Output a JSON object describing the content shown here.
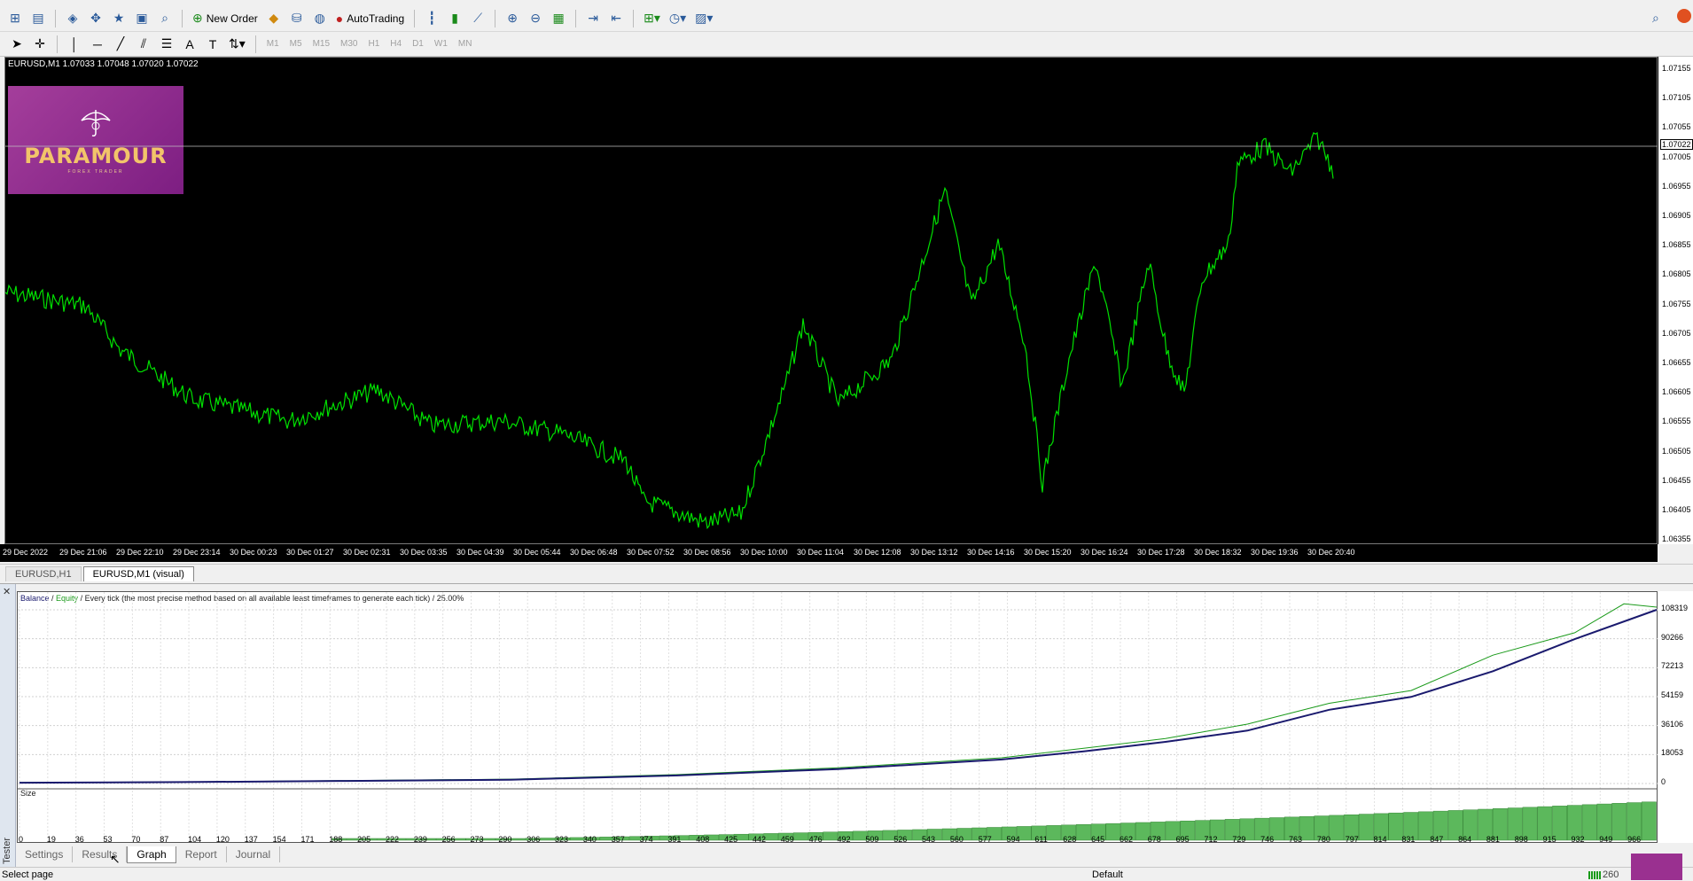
{
  "toolbar": {
    "new_order": "New Order",
    "auto_trading": "AutoTrading",
    "timeframes": [
      "M1",
      "M5",
      "M15",
      "M30",
      "H1",
      "H4",
      "D1",
      "W1",
      "MN"
    ]
  },
  "chart": {
    "info": "EURUSD,M1  1.07033 1.07048 1.07020 1.07022",
    "current_price": "1.07022",
    "logo_word": "PARAMOUR",
    "logo_sub": "FOREX TRADER",
    "line_color": "#00e000",
    "price_ticks": [
      "1.07155",
      "1.07105",
      "1.07055",
      "1.07005",
      "1.06955",
      "1.06905",
      "1.06855",
      "1.06805",
      "1.06755",
      "1.06705",
      "1.06655",
      "1.06605",
      "1.06555",
      "1.06505",
      "1.06455",
      "1.06405",
      "1.06355"
    ],
    "time_ticks": [
      "29 Dec 2022",
      "29 Dec 21:06",
      "29 Dec 22:10",
      "29 Dec 23:14",
      "30 Dec 00:23",
      "30 Dec 01:27",
      "30 Dec 02:31",
      "30 Dec 03:35",
      "30 Dec 04:39",
      "30 Dec 05:44",
      "30 Dec 06:48",
      "30 Dec 07:52",
      "30 Dec 08:56",
      "30 Dec 10:00",
      "30 Dec 11:04",
      "30 Dec 12:08",
      "30 Dec 13:12",
      "30 Dec 14:16",
      "30 Dec 15:20",
      "30 Dec 16:24",
      "30 Dec 17:28",
      "30 Dec 18:32",
      "30 Dec 19:36",
      "30 Dec 20:40"
    ]
  },
  "chart_tabs": [
    {
      "label": "EURUSD,H1",
      "active": false
    },
    {
      "label": "EURUSD,M1 (visual)",
      "active": true
    }
  ],
  "tester": {
    "side_label": "Tester",
    "legend_balance": "Balance",
    "legend_sep1": " / ",
    "legend_equity": "Equity",
    "legend_rest": " / Every tick (the most precise method based on all available least timeframes to generate each tick) / 25.00%",
    "size_label": "Size",
    "balance_color": "#1a1a6e",
    "equity_color": "#1a9a1a",
    "tabs": [
      {
        "label": "Settings",
        "active": false
      },
      {
        "label": "Results",
        "active": false
      },
      {
        "label": "Graph",
        "active": true
      },
      {
        "label": "Report",
        "active": false
      },
      {
        "label": "Journal",
        "active": false
      }
    ]
  },
  "chart_data": {
    "type": "line",
    "y_ticks": [
      "108319",
      "90266",
      "72213",
      "54159",
      "36106",
      "18053",
      "0"
    ],
    "x_ticks": [
      "0",
      "19",
      "36",
      "53",
      "70",
      "87",
      "104",
      "120",
      "137",
      "154",
      "171",
      "188",
      "205",
      "222",
      "239",
      "256",
      "273",
      "290",
      "306",
      "323",
      "340",
      "357",
      "374",
      "391",
      "408",
      "425",
      "442",
      "459",
      "476",
      "492",
      "509",
      "526",
      "543",
      "560",
      "577",
      "594",
      "611",
      "628",
      "645",
      "662",
      "678",
      "695",
      "712",
      "729",
      "746",
      "763",
      "780",
      "797",
      "814",
      "831",
      "847",
      "864",
      "881",
      "898",
      "915",
      "932",
      "949",
      "966"
    ],
    "ylim": [
      0,
      108319
    ],
    "xlim": [
      0,
      1000
    ],
    "series": [
      {
        "name": "Balance",
        "x": [
          0,
          100,
          200,
          300,
          400,
          500,
          600,
          650,
          700,
          750,
          800,
          850,
          900,
          950,
          1000
        ],
        "values": [
          500,
          900,
          1600,
          2400,
          5000,
          9000,
          15000,
          20000,
          26000,
          33000,
          46000,
          54000,
          70000,
          90000,
          108300
        ]
      },
      {
        "name": "Equity",
        "x": [
          0,
          100,
          200,
          300,
          400,
          500,
          600,
          650,
          700,
          750,
          800,
          850,
          900,
          950,
          980,
          1000
        ],
        "values": [
          600,
          1000,
          1800,
          2700,
          5500,
          9800,
          16000,
          22000,
          28000,
          37000,
          50000,
          58000,
          80000,
          94000,
          112000,
          110000
        ]
      }
    ]
  },
  "status": {
    "left": "Select page",
    "profile": "Default",
    "right": "260"
  }
}
